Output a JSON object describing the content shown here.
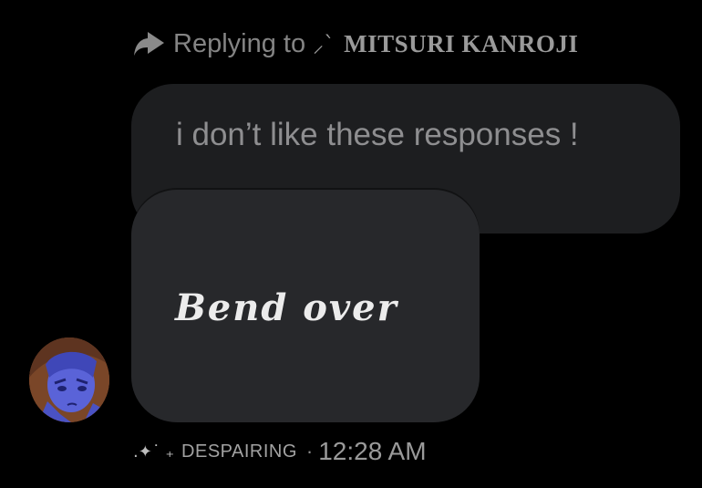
{
  "reply": {
    "prefix": "Replying to",
    "decoration": "⸝`",
    "name": "MITSURI KANROJI",
    "icon": "reply-arrow-icon"
  },
  "quoted_message": {
    "text": "i don’t like these responses !"
  },
  "message": {
    "text": "Bend over"
  },
  "avatar": {
    "icon": "user-avatar"
  },
  "footer": {
    "decoration": ".✦˙ ₊",
    "status": "DESPAIRING",
    "separator": "·",
    "timestamp": "12:28 AM"
  },
  "colors": {
    "background": "#000000",
    "quoted_bubble": "#1d1e20",
    "message_bubble": "#27282b",
    "muted_text": "#8e8e90",
    "message_text": "#ececec",
    "avatar_tint": "#5a63d8"
  }
}
